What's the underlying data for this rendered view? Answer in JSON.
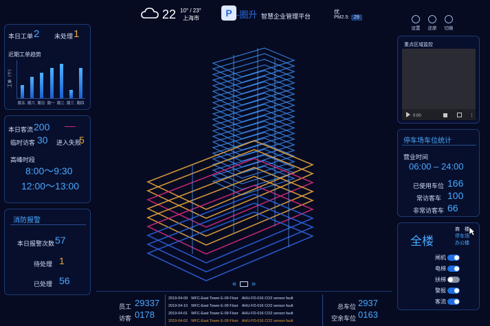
{
  "header": {
    "temperature": "22",
    "temp_range": "10° / 23°",
    "city": "上海市",
    "logo_text": "-圈升",
    "platform_title": "智慧企业管理平台",
    "air_quality": "优",
    "pm_label": "PM2.5:",
    "pm_value": "29",
    "actions": [
      {
        "label": "设置",
        "icon": "gear-icon"
      },
      {
        "label": "还原",
        "icon": "restore-icon"
      },
      {
        "label": "切换",
        "icon": "switch-icon"
      }
    ]
  },
  "work_orders": {
    "today_label": "本日工单",
    "today_value": "2",
    "pending_label": "未处理",
    "pending_value": "1",
    "trend_title": "近期工单趋势",
    "ylabel": "工单（个）",
    "chart_data": {
      "type": "bar",
      "categories": [
        "周五",
        "周六",
        "周日",
        "周一",
        "周二",
        "周三",
        "周四"
      ],
      "values": [
        3,
        5,
        6,
        7,
        8,
        2,
        7
      ],
      "ylabel": "工单（个）",
      "ylim": [
        0,
        9
      ]
    }
  },
  "visitors": {
    "today_label": "本日客流",
    "today_value": "200",
    "temp_label": "临时访客",
    "temp_value": "30",
    "lost_label": "进入失败",
    "lost_value": "5",
    "peak_label": "高峰时段",
    "peak_1": "8:00～9:30",
    "peak_2": "12:00～13:00"
  },
  "fire": {
    "title": "消防报警",
    "rows": [
      {
        "label": "本日报警次数",
        "value": "57"
      },
      {
        "label": "待处理",
        "value": "1"
      },
      {
        "label": "已处理",
        "value": "56"
      }
    ]
  },
  "camera": {
    "title": "重点区域监控",
    "time": "0:00"
  },
  "parking": {
    "title": "停车场车位统计",
    "hours_label": "营业时间",
    "hours_value": "06:00 – 24:00",
    "rows": [
      {
        "label": "已使用车位",
        "value": "166"
      },
      {
        "label": "常访客车",
        "value": "100"
      },
      {
        "label": "非常访客车",
        "value": "66"
      }
    ]
  },
  "building": {
    "title": "全楼",
    "nav": [
      "商　楼",
      "停车场",
      "办公楼"
    ],
    "toggles": [
      {
        "label": "闸机",
        "on": true
      },
      {
        "label": "电梯",
        "on": true
      },
      {
        "label": "扶梯",
        "on": false
      },
      {
        "label": "警报",
        "on": true
      },
      {
        "label": "客流",
        "on": true
      }
    ]
  },
  "bottom": {
    "staff_label": "员工",
    "staff_value": "29337",
    "visitor_label": "访客",
    "visitor_value": "0178",
    "total_parking_label": "总车位",
    "total_parking_value": "2937",
    "free_parking_label": "空余车位",
    "free_parking_value": "0163",
    "tickets": [
      {
        "date": "2019-04-09",
        "location": "WFC-East Tower E-09 Floor",
        "message": "AHU-FD-016 CO2 sensor fault",
        "color": "#cfe0ff"
      },
      {
        "date": "2019-04-10",
        "location": "WFC-East Tower E-09 Floor",
        "message": "AHU-FD-016 CO2 sensor fault",
        "color": "#cfe0ff"
      },
      {
        "date": "2019-04-01",
        "location": "WFC-East Tower E-09 Floor",
        "message": "AHU-FD-016 CO2 sensor fault",
        "color": "#cfe0ff"
      },
      {
        "date": "2019-04-02",
        "location": "WFC-East Tower E-09 Floor",
        "message": "AHU-FD-016 CO2 sensor fault",
        "color": "#e9a43b"
      }
    ]
  },
  "colors": {
    "accent": "#4aa8ff",
    "warn": "#e9a43b",
    "magenta": "#d1287a",
    "background": "#060b22"
  }
}
